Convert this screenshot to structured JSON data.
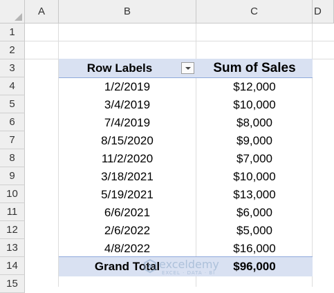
{
  "columns": {
    "a": "A",
    "b": "B",
    "c": "C",
    "d": "D"
  },
  "row_numbers": [
    "1",
    "2",
    "3",
    "4",
    "5",
    "6",
    "7",
    "8",
    "9",
    "10",
    "11",
    "12",
    "13",
    "14",
    "15"
  ],
  "pivot": {
    "header_row_labels": "Row Labels",
    "header_sum": "Sum of Sales",
    "rows": [
      {
        "label": "1/2/2019",
        "value": "$12,000"
      },
      {
        "label": "3/4/2019",
        "value": "$10,000"
      },
      {
        "label": "7/4/2019",
        "value": "$8,000"
      },
      {
        "label": "8/15/2020",
        "value": "$9,000"
      },
      {
        "label": "11/2/2020",
        "value": "$7,000"
      },
      {
        "label": "3/18/2021",
        "value": "$10,000"
      },
      {
        "label": "5/19/2021",
        "value": "$13,000"
      },
      {
        "label": "6/6/2021",
        "value": "$6,000"
      },
      {
        "label": "2/6/2022",
        "value": "$5,000"
      },
      {
        "label": "4/8/2022",
        "value": "$16,000"
      }
    ],
    "total_label": "Grand Total",
    "total_value": "$96,000"
  },
  "watermark": {
    "name": "exceldemy",
    "tagline": "EXCEL · DATA · BI"
  },
  "colors": {
    "pivot_header_fill": "#d9e1f2",
    "pivot_border": "#8ea9db",
    "header_fill": "#efefef"
  }
}
